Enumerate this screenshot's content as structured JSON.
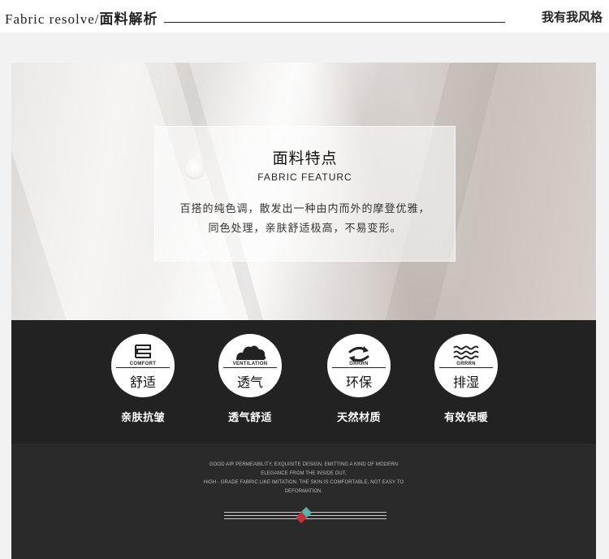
{
  "header": {
    "title_en": "Fabric resolve/",
    "title_cn": "面料解析",
    "right_text": "我有我风格"
  },
  "card": {
    "title": "面料特点",
    "subtitle": "FABRIC FEATURC",
    "line1": "百搭的纯色调，散发出一种由内而外的摩登优雅，",
    "line2": "同色处理，亲肤舒适极高，不易变形。"
  },
  "features": [
    {
      "icon": "comfort-icon",
      "label_en": "COMFORT",
      "label_cn": "舒适",
      "caption": "亲肤抗皱"
    },
    {
      "icon": "ventilation-icon",
      "label_en": "VENTILATION",
      "label_cn": "透气",
      "caption": "透气舒适"
    },
    {
      "icon": "eco-arrows-icon",
      "label_en": "GRRRN",
      "label_cn": "环保",
      "caption": "天然材质"
    },
    {
      "icon": "moisture-wave-icon",
      "label_en": "GRRRN",
      "label_cn": "排湿",
      "caption": "有效保暖"
    }
  ],
  "footer": {
    "line1": "GOOD AIR PERMEABILITY, EXQUISITE DESIGN, EMITTING A KIND OF MODERN",
    "line2": "ELEGANCE FROM THE INSIDE OUT,",
    "line3": "HIGH - GRADE FABRIC LIKE IMITATION. THE SKIN IS COMFORTABLE, NOT EASY TO",
    "line4": "DEFORMATION."
  },
  "colors": {
    "dark_panel": "#222222",
    "accent_teal": "#56b3a9",
    "accent_red": "#c0343b"
  }
}
